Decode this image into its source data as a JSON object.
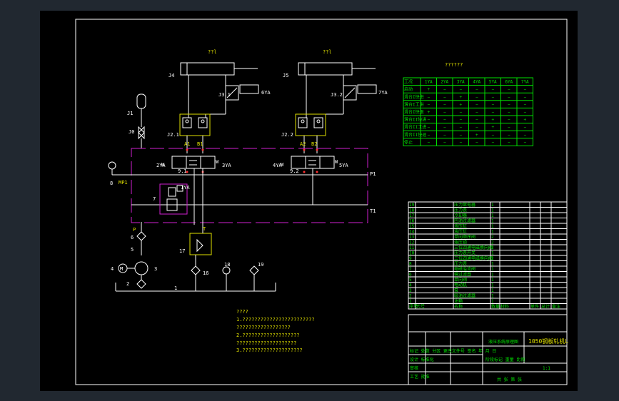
{
  "labels": {
    "cyl1_title": "??l",
    "cyl2_title": "??l",
    "table_title": "??????",
    "j4": "J4",
    "j5": "J5",
    "j1": "J1",
    "j0": "J0",
    "j3_1": "J3.1",
    "j3_2": "J3.2",
    "j2_1": "J2.1",
    "j2_2": "J2.2",
    "v6ya": "6YA",
    "v7ya": "7YA",
    "a1": "A1",
    "b1": "B1",
    "a2": "A2",
    "b2": "B2",
    "v2ya": "2YA",
    "v3ya": "3YA",
    "v4ya": "4YA",
    "v5ya": "5YA",
    "n9_1": "9.1",
    "n9_2": "9.2",
    "p1": "P1",
    "t1": "T1",
    "mp1": "MP1",
    "n8": "8",
    "n7": "7",
    "v1ya": "1YA",
    "p": "P",
    "t": "T",
    "n6": "6",
    "n5": "5",
    "n4": "4",
    "n3": "3",
    "n2": "2",
    "n1": "1",
    "n17": "17",
    "n16": "16",
    "n18": "18",
    "n19": "19",
    "m": "M"
  },
  "notes": [
    "????",
    "1.????????????????????????",
    "  ??????????????????",
    "2.???????????????????",
    "  ????????????????????",
    "3.????????????????????"
  ],
  "action_table": {
    "headers": [
      "工况",
      "1YA",
      "2YA",
      "3YA",
      "4YA",
      "5YA",
      "6YA",
      "7YA"
    ],
    "rows": [
      [
        "启动",
        "+",
        "−",
        "−",
        "−",
        "−",
        "−",
        "−"
      ],
      [
        "滑台I快进",
        "−",
        "−",
        "+",
        "−",
        "−",
        "−",
        "−"
      ],
      [
        "滑台I工进",
        "−",
        "−",
        "+",
        "−",
        "−",
        "−",
        "−"
      ],
      [
        "滑台I快退",
        "+",
        "−",
        "−",
        "−",
        "−",
        "−",
        "−"
      ],
      [
        "滑台II快进",
        "−",
        "−",
        "−",
        "−",
        "+",
        "−",
        "+"
      ],
      [
        "滑台II工进",
        "−",
        "−",
        "−",
        "−",
        "+",
        "−",
        "−"
      ],
      [
        "滑台II快退",
        "−",
        "−",
        "−",
        "+",
        "−",
        "−",
        "−"
      ],
      [
        "停止",
        "−",
        "−",
        "−",
        "−",
        "−",
        "−",
        "−"
      ]
    ]
  },
  "parts_list": {
    "rows": [
      [
        "19",
        "",
        "压力继电器",
        "1"
      ],
      [
        "18",
        "",
        "压力表",
        "1"
      ],
      [
        "17",
        "",
        "冷却器",
        "1"
      ],
      [
        "16",
        "",
        "回油过滤器",
        "1"
      ],
      [
        "15",
        "",
        "液压缸",
        "1"
      ],
      [
        "14",
        "",
        "液压缸",
        "1"
      ],
      [
        "13",
        "",
        "单向顺序阀",
        "2"
      ],
      [
        "12",
        "",
        "液压锁",
        "2"
      ],
      [
        "11",
        "",
        "三位四通电磁换向阀",
        "2"
      ],
      [
        "10",
        "",
        "压力表开关",
        "1"
      ],
      [
        "9",
        "",
        "三位四通电磁换向阀",
        "2"
      ],
      [
        "8",
        "",
        "压力表",
        "1"
      ],
      [
        "7",
        "",
        "电磁溢流阀",
        "1"
      ],
      [
        "6",
        "",
        "精过滤器",
        "1"
      ],
      [
        "5",
        "",
        "单向阀",
        "1"
      ],
      [
        "4",
        "",
        "电动机",
        "1"
      ],
      [
        "3",
        "",
        "泵",
        "1"
      ],
      [
        "2",
        "",
        "吸油过滤器",
        "1"
      ],
      [
        "1",
        "",
        "油箱",
        "1"
      ]
    ],
    "header": [
      "序号",
      "代号",
      "名称",
      "数量",
      "材料",
      "单件",
      "总计",
      "备注"
    ]
  },
  "title_block": {
    "drawing_name": "液压系统原理图",
    "school": "1050钢板轧机L",
    "rows": [
      "标记 处数 分区 更改文件号 签名 年 月 日",
      "设计 标准化",
      "审核",
      "工艺 批准"
    ],
    "stage_label": "阶段标记 重量 比例",
    "sheet_label": "共 张 第 张",
    "scale": "1:1"
  },
  "colors": {
    "line": "#ffffff",
    "table": "#00e000",
    "dashed": "#d020d0",
    "label": "#e0e000",
    "port": "#ff3030",
    "background": "#000000"
  }
}
